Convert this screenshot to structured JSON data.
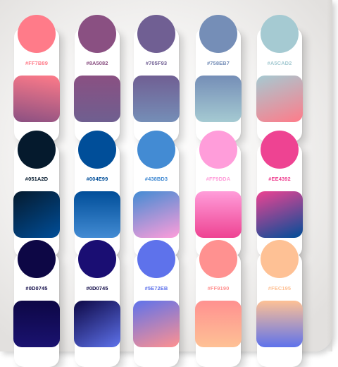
{
  "swatches": [
    {
      "hex": "#FF7B89",
      "label_color": "#FF7B89",
      "circle": "#FF7B89",
      "gradient": [
        "#8A5082",
        "#FF7B89"
      ],
      "angle": "10deg"
    },
    {
      "hex": "#8A5082",
      "label_color": "#8A5082",
      "circle": "#8A5082",
      "gradient": [
        "#8A5082",
        "#6F5F90"
      ],
      "angle": "180deg"
    },
    {
      "hex": "#705F93",
      "label_color": "#705F93",
      "circle": "#705F93",
      "gradient": [
        "#705F93",
        "#758EB7"
      ],
      "angle": "180deg"
    },
    {
      "hex": "#758EB7",
      "label_color": "#758EB7",
      "circle": "#758EB7",
      "gradient": [
        "#758EB7",
        "#A5CAD2"
      ],
      "angle": "180deg"
    },
    {
      "hex": "#A5CAD2",
      "label_color": "#A5CAD2",
      "circle": "#A5CAD2",
      "gradient": [
        "#A5CAD2",
        "#FF7B89"
      ],
      "angle": "160deg"
    },
    {
      "hex": "#051A2D",
      "label_color": "#051A2D",
      "circle": "#051A2D",
      "gradient": [
        "#051A2D",
        "#004E99"
      ],
      "angle": "150deg"
    },
    {
      "hex": "#004E99",
      "label_color": "#004E99",
      "circle": "#004E99",
      "gradient": [
        "#004E99",
        "#438BD3"
      ],
      "angle": "180deg"
    },
    {
      "hex": "#438BD3",
      "label_color": "#438BD3",
      "circle": "#438BD3",
      "gradient": [
        "#438BD3",
        "#FF9DDA"
      ],
      "angle": "160deg"
    },
    {
      "hex": "#FF9DDA",
      "label_color": "#FF9DDA",
      "circle": "#FF9DDA",
      "gradient": [
        "#FF9DDA",
        "#EE4392"
      ],
      "angle": "180deg"
    },
    {
      "hex": "#EE4392",
      "label_color": "#EE4392",
      "circle": "#EE4392",
      "gradient": [
        "#EE4392",
        "#004E99"
      ],
      "angle": "160deg"
    },
    {
      "hex": "#0D0745",
      "label_color": "#0D0745",
      "circle": "#0D0745",
      "gradient": [
        "#0D0745",
        "#1A1270"
      ],
      "angle": "180deg"
    },
    {
      "hex": "#0D0745",
      "label_color": "#0D0745",
      "circle": "#1A0E73",
      "gradient": [
        "#0D0745",
        "#5E72EB"
      ],
      "angle": "150deg"
    },
    {
      "hex": "#5E72EB",
      "label_color": "#5E72EB",
      "circle": "#5E72EB",
      "gradient": [
        "#5E72EB",
        "#FF9190"
      ],
      "angle": "160deg"
    },
    {
      "hex": "#FF9190",
      "label_color": "#FF9190",
      "circle": "#FF9190",
      "gradient": [
        "#FF9190",
        "#FEC195"
      ],
      "angle": "180deg"
    },
    {
      "hex": "#FEC195",
      "label_color": "#FEC195",
      "circle": "#FEC195",
      "gradient": [
        "#FEC195",
        "#5E72EB"
      ],
      "angle": "180deg"
    }
  ]
}
